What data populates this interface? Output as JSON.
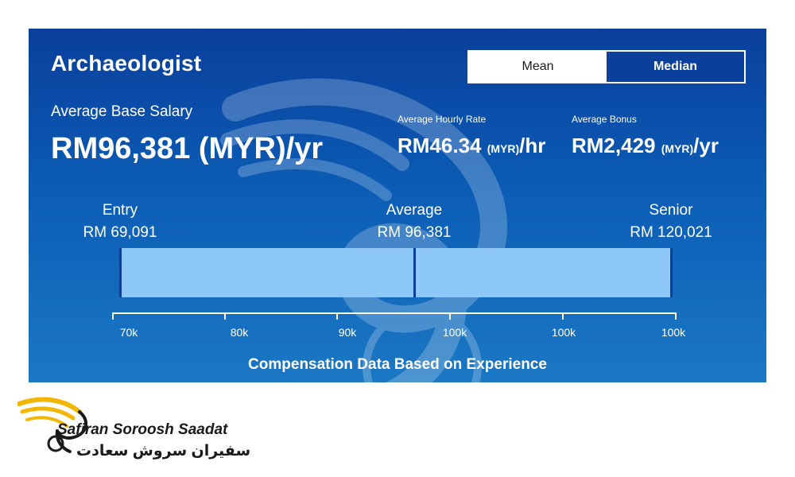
{
  "card": {
    "title": "Archaeologist",
    "toggle": {
      "mean_label": "Mean",
      "median_label": "Median",
      "selected": "Mean"
    },
    "base_salary": {
      "label": "Average Base Salary",
      "value": "RM96,381 (MYR)/yr"
    },
    "hourly": {
      "label": "Average Hourly Rate",
      "amount": "RM46.34",
      "unit": "(MYR)",
      "suffix": "/hr"
    },
    "bonus": {
      "label": "Average Bonus",
      "amount": "RM2,429",
      "unit": "(MYR)",
      "suffix": "/yr"
    },
    "levels": [
      {
        "name": "Entry",
        "value": "RM 69,091"
      },
      {
        "name": "Average",
        "value": "RM 96,381"
      },
      {
        "name": "Senior",
        "value": "RM 120,021"
      }
    ],
    "axis_ticks": [
      "70k",
      "80k",
      "90k",
      "100k",
      "100k",
      "100k"
    ],
    "footer": "Compensation Data Based on Experience",
    "colors": {
      "card_top": "#0a3f9c",
      "card_bottom": "#1b78c4",
      "bar": "#8ec8f8",
      "accent_gold": "#f2b705"
    }
  },
  "brand": {
    "name_en": "Safiran Soroosh Saadat",
    "name_fa": "سفیران سروش سعادت",
    "icon": "winged-s-logo"
  }
}
